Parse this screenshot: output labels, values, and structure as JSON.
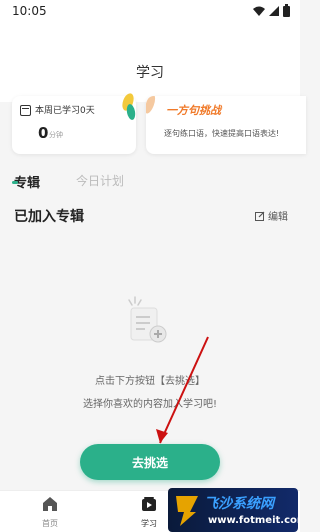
{
  "status_bar": {
    "time": "10:05",
    "icons": [
      "wifi-icon",
      "signal-icon",
      "battery-icon"
    ]
  },
  "header": {
    "title": "学习"
  },
  "study_card": {
    "label": "本周已学习0天",
    "count": "0",
    "unit": "分钟"
  },
  "challenge_card": {
    "title": "一方句挑战",
    "description": "逐句练口语，快速提高口语表达!"
  },
  "tabs": [
    {
      "label": "专辑",
      "active": true
    },
    {
      "label": "今日计划",
      "active": false
    }
  ],
  "section": {
    "title": "已加入专辑",
    "edit_label": "编辑"
  },
  "empty_state": {
    "icon": "document-add-icon",
    "line1": "点击下方按钮【去挑选】",
    "line2": "选择你喜欢的内容加入学习吧!"
  },
  "primary_button": {
    "label": "去挑选"
  },
  "bottom_nav": [
    {
      "label": "首页",
      "icon": "home-icon",
      "active": false
    },
    {
      "label": "学习",
      "icon": "study-icon",
      "active": true
    }
  ],
  "watermark": {
    "title": "飞沙系统网",
    "url": "www.fotmeit.com"
  },
  "colors": {
    "accent": "#2bb08a",
    "challenge_title": "#f07a2a",
    "annotation_arrow": "#cc1111"
  }
}
